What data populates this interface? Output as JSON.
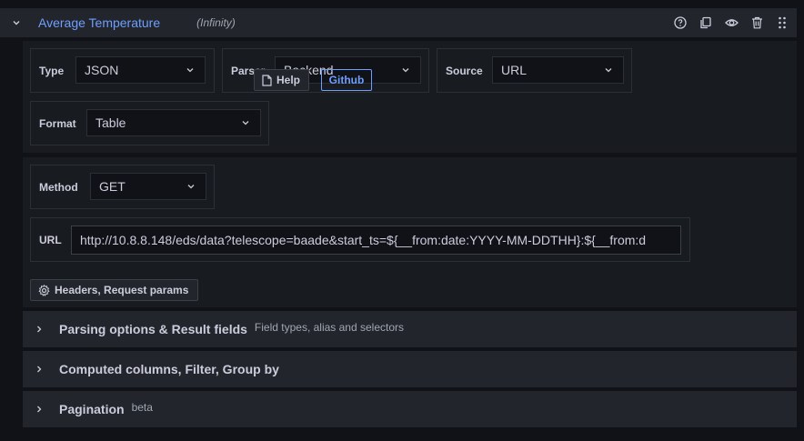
{
  "query": {
    "title": "Average Temperature",
    "datasource": "(Infinity)",
    "actions": [
      "help-icon",
      "duplicate-icon",
      "eye-icon",
      "trash-icon",
      "drag-icon"
    ]
  },
  "fields": {
    "type": {
      "label": "Type",
      "value": "JSON"
    },
    "parser": {
      "label": "Parser",
      "value": "Backend"
    },
    "source": {
      "label": "Source",
      "value": "URL"
    },
    "format": {
      "label": "Format",
      "value": "Table"
    },
    "method": {
      "label": "Method",
      "value": "GET"
    },
    "url": {
      "label": "URL",
      "value": "http://10.8.8.148/eds/data?telescope=baade&start_ts=${__from:date:YYYY-MM-DDTHH}:${__from:d"
    }
  },
  "buttons": {
    "help": "Help",
    "github": "Github",
    "headers": "Headers, Request params"
  },
  "sections": [
    {
      "title": "Parsing options & Result fields",
      "subtitle": "Field types, alias and selectors"
    },
    {
      "title": "Computed columns, Filter, Group by",
      "subtitle": ""
    },
    {
      "title": "Pagination",
      "subtitle": "beta"
    }
  ],
  "colors": {
    "accent": "#6e9fff",
    "background": "#111217",
    "panel": "#181b1f"
  }
}
